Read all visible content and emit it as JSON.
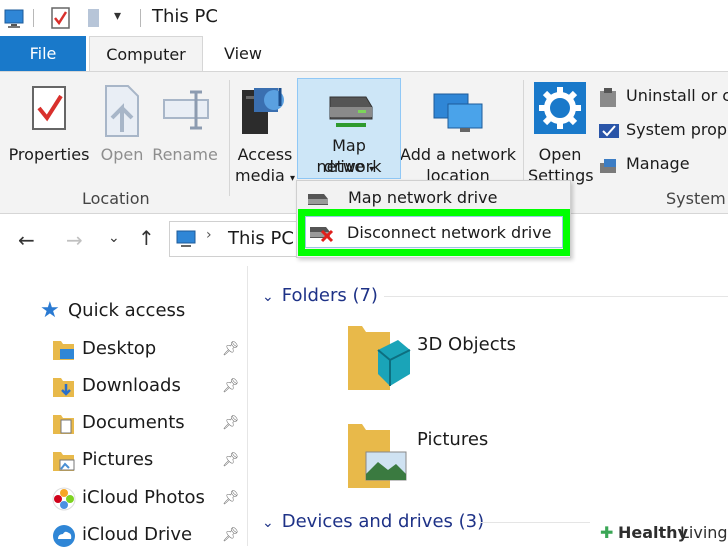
{
  "window": {
    "title": "This PC"
  },
  "tabs": {
    "file": "File",
    "computer": "Computer",
    "view": "View"
  },
  "ribbon": {
    "location": {
      "group_label": "Location",
      "properties": "Properties",
      "open": "Open",
      "rename": "Rename"
    },
    "network": {
      "access_media_l1": "Access",
      "access_media_l2": "media",
      "map_drive_l1": "Map network",
      "map_drive_l2": "drive",
      "add_location_l1": "Add a network",
      "add_location_l2": "location"
    },
    "system": {
      "group_label": "System",
      "open_settings_l1": "Open",
      "open_settings_l2": "Settings",
      "uninstall": "Uninstall or ch",
      "system_properties": "System prope",
      "manage": "Manage"
    }
  },
  "dropdown": {
    "items": [
      "Map network drive",
      "Disconnect network drive"
    ],
    "highlight_color": "#00ff00"
  },
  "address": {
    "path": "This PC"
  },
  "nav_pane": {
    "quick_access": "Quick access",
    "items": [
      "Desktop",
      "Downloads",
      "Documents",
      "Pictures",
      "iCloud Photos",
      "iCloud Drive"
    ]
  },
  "content": {
    "folders_header": "Folders (7)",
    "folders": [
      "3D Objects",
      "Pictures"
    ],
    "devices_header": "Devices and drives (3)"
  },
  "watermark": {
    "part1": "Healthy",
    "part2": "Living"
  },
  "colors": {
    "accent": "#1979ca",
    "section_header": "#1e3287"
  }
}
